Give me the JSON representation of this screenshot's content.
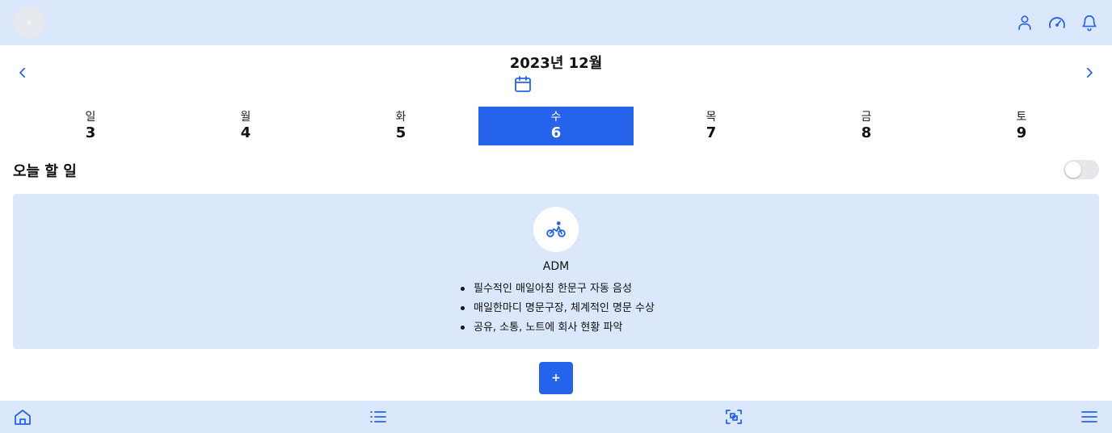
{
  "header": {
    "icons": [
      "avatar",
      "user-icon",
      "speedometer-icon",
      "bell-icon"
    ]
  },
  "calendar": {
    "month_title": "2023년 12월",
    "prev_icon": "chevron-left-icon",
    "next_icon": "chevron-right-icon",
    "picker_icon": "calendar-icon",
    "days": [
      {
        "dow": "일",
        "num": "3"
      },
      {
        "dow": "월",
        "num": "4"
      },
      {
        "dow": "화",
        "num": "5"
      },
      {
        "dow": "수",
        "num": "6"
      },
      {
        "dow": "목",
        "num": "7"
      },
      {
        "dow": "금",
        "num": "8"
      },
      {
        "dow": "토",
        "num": "9"
      }
    ],
    "selected_index": 3
  },
  "section": {
    "title": "오늘 할 일",
    "toggle_on": false
  },
  "task_card": {
    "icon": "bicycle-icon",
    "title": "ADM",
    "items": [
      "필수적인 매일아침 한문구 자동 음성",
      "매일한마디 명문구장, 체계적인 명문 수상",
      "공유, 소통, 노트에 회사 현황 파악"
    ]
  },
  "add_button_label": "+",
  "bottom_nav": {
    "icons": [
      "home-icon",
      "list-icon",
      "scan-icon",
      "menu-icon"
    ]
  },
  "colors": {
    "accent": "#2563eb",
    "bar_bg": "#dbe8fb",
    "icon": "#2563eb"
  }
}
